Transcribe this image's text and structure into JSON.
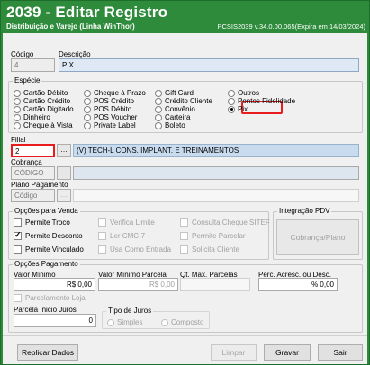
{
  "window": {
    "title": "2039 - Editar Registro",
    "subtitle": "Distribuição e Varejo (Linha WinThor)",
    "version": "PCSIS2039  v.34.0.00.065(Expira em 14/03/2024)"
  },
  "codigo": {
    "label": "Código",
    "value": "4"
  },
  "descricao": {
    "label": "Descrição",
    "value": "PIX"
  },
  "especie": {
    "label": "Espécie",
    "options": [
      [
        "Cartão Débito",
        "Cartão Crédito",
        "Cartão Digitado",
        "Dinheiro",
        "Cheque à Vista"
      ],
      [
        "Cheque à Prazo",
        "POS Crédito",
        "POS Débito",
        "POS Voucher",
        "Private Label"
      ],
      [
        "Gift Card",
        "Crédito Cliente",
        "Convênio",
        "Carteira",
        "Boleto"
      ],
      [
        "Outros",
        "Pontos Fidelidade",
        "Pix"
      ]
    ],
    "selected": "Pix"
  },
  "filial": {
    "label": "Filial",
    "value": "2",
    "description": "(V) TECH-L CONS. IMPLANT. E TREINAMENTOS"
  },
  "cobranca": {
    "label": "Cobrança",
    "placeholder": "CÓDIGO"
  },
  "plano_pagamento": {
    "label": "Plano Pagamento",
    "placeholder": "Código"
  },
  "opcoes_venda": {
    "title": "Opções para Venda",
    "checks": [
      {
        "label": "Permite Troco",
        "checked": false,
        "enabled": true
      },
      {
        "label": "Verifica Limite",
        "checked": false,
        "enabled": false
      },
      {
        "label": "Consulta Cheque SITEF",
        "checked": false,
        "enabled": false
      },
      {
        "label": "Permite Desconto",
        "checked": true,
        "enabled": true
      },
      {
        "label": "Ler CMC-7",
        "checked": false,
        "enabled": false
      },
      {
        "label": "Permite Parcelar",
        "checked": false,
        "enabled": false
      },
      {
        "label": "Permite Vinculado",
        "checked": false,
        "enabled": true
      },
      {
        "label": "Usa Como Entrada",
        "checked": false,
        "enabled": false
      },
      {
        "label": "Solicita Cliente",
        "checked": false,
        "enabled": false
      }
    ]
  },
  "integracao_pdv": {
    "title": "Integração PDV",
    "button": "Cobrança/Plano"
  },
  "opcoes_pagamento": {
    "title": "Opções Pagamento",
    "valor_minimo": {
      "label": "Valor Mínimo",
      "value": "R$ 0,00"
    },
    "valor_minimo_parcela": {
      "label": "Valor Mínimo Parcela",
      "value": "R$ 0,00"
    },
    "qt_max_parcelas": {
      "label": "Qt. Max. Parcelas",
      "value": ""
    },
    "perc_acresc": {
      "label": "Perc. Acrésc. ou Desc.",
      "value": "% 0,00"
    },
    "parcelamento_loja": "Parcelamento Loja",
    "parcela_inicio": {
      "label": "Parcela Inicio Juros",
      "value": "0"
    },
    "tipo_juros": {
      "label": "Tipo de Juros",
      "options": [
        "Simples",
        "Composto"
      ]
    }
  },
  "buttons": {
    "replicar": "Replicar Dados",
    "limpar": "Limpar",
    "gravar": "Gravar",
    "sair": "Sair"
  },
  "colors": {
    "titlebar": "#2e8b3c",
    "highlight": "#e81c1c"
  }
}
